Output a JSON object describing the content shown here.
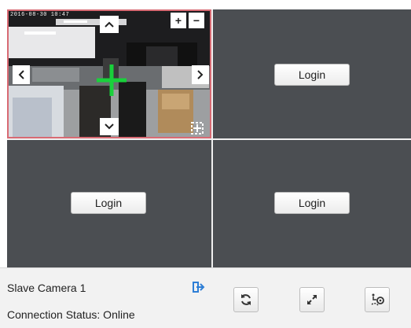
{
  "tiles": [
    {
      "id": 1,
      "overlay_text": "2016-08-30 10:47"
    },
    {
      "id": 2,
      "login_label": "Login"
    },
    {
      "id": 3,
      "login_label": "Login"
    },
    {
      "id": 4,
      "login_label": "Login"
    }
  ],
  "ptz": {
    "zoom_in": "+",
    "zoom_out": "−",
    "up": "˄",
    "down": "˅",
    "left": "‹",
    "right": "›"
  },
  "panel": {
    "camera_name": "Slave Camera 1",
    "connection_status": "Connection Status: Online"
  },
  "icons": {
    "logout": "logout-icon",
    "refresh": "refresh-icon",
    "fullscreen": "fullscreen-icon",
    "track": "track-icon"
  },
  "colors": {
    "selected_border": "#d86a73",
    "tile_background": "#4b4e52",
    "accent_blue": "#2f7fd6",
    "crosshair": "#19d13b"
  }
}
